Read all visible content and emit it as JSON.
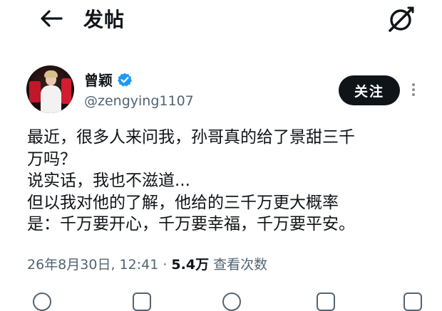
{
  "header": {
    "title": "发帖"
  },
  "author": {
    "display_name": "曾颖",
    "handle": "@zengying1107",
    "verified": true,
    "follow_label": "关注"
  },
  "post": {
    "lines": [
      "最近，很多人来问我，孙哥真的给了景甜三千",
      "万吗？",
      "说实话，我也不滋道...",
      "但以我对他的了解，他给的三千万更大概率",
      "是：千万要开心，千万要幸福，千万要平安。"
    ]
  },
  "meta": {
    "datetime": "26年8月30日, 12:41",
    "separator": "·",
    "views": "5.4万",
    "views_label": "查看次数"
  },
  "colors": {
    "text": "#0f1419",
    "secondary": "#536471",
    "verified_badge": "#1d9bf0",
    "follow_bg": "#0f1419"
  },
  "icons": {
    "back": "arrow-left-icon",
    "grok": "grok-icon",
    "verified": "verified-badge-icon",
    "more": "more-vertical-icon"
  }
}
